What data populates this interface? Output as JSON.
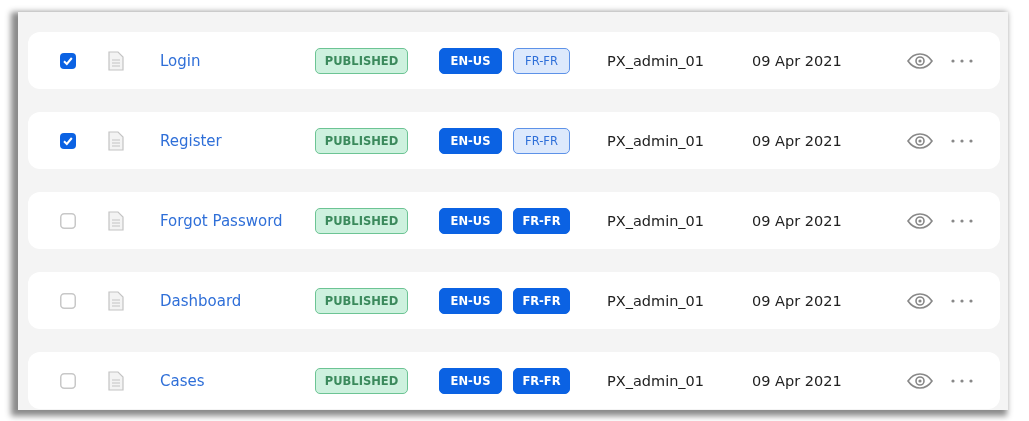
{
  "rows": [
    {
      "checked": true,
      "name": "Login",
      "status": "PUBLISHED",
      "locales": [
        {
          "label": "EN-US",
          "active": true
        },
        {
          "label": "FR-FR",
          "active": false
        }
      ],
      "author": "PX_admin_01",
      "date": "09 Apr 2021"
    },
    {
      "checked": true,
      "name": "Register",
      "status": "PUBLISHED",
      "locales": [
        {
          "label": "EN-US",
          "active": true
        },
        {
          "label": "FR-FR",
          "active": false
        }
      ],
      "author": "PX_admin_01",
      "date": "09 Apr 2021"
    },
    {
      "checked": false,
      "name": "Forgot Password",
      "status": "PUBLISHED",
      "locales": [
        {
          "label": "EN-US",
          "active": true
        },
        {
          "label": "FR-FR",
          "active": true
        }
      ],
      "author": "PX_admin_01",
      "date": "09 Apr 2021"
    },
    {
      "checked": false,
      "name": "Dashboard",
      "status": "PUBLISHED",
      "locales": [
        {
          "label": "EN-US",
          "active": true
        },
        {
          "label": "FR-FR",
          "active": true
        }
      ],
      "author": "PX_admin_01",
      "date": "09 Apr 2021"
    },
    {
      "checked": false,
      "name": "Cases",
      "status": "PUBLISHED",
      "locales": [
        {
          "label": "EN-US",
          "active": true
        },
        {
          "label": "FR-FR",
          "active": true
        }
      ],
      "author": "PX_admin_01",
      "date": "09 Apr 2021"
    }
  ]
}
